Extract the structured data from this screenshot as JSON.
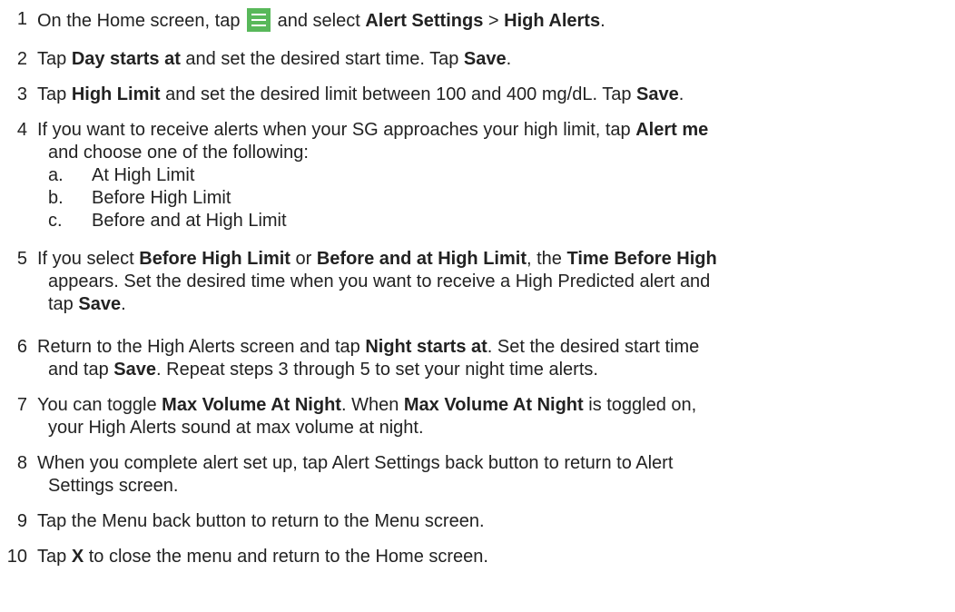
{
  "steps": [
    {
      "num": "1",
      "t1": "On the Home screen, tap ",
      "icon": "menu-icon",
      "t2": " and select ",
      "b1": "Alert Settings",
      "t3": " > ",
      "b2": "High Alerts",
      "t4": "."
    },
    {
      "num": "2",
      "t1": "Tap ",
      "b1": "Day starts at",
      "t2": " and set the desired start time. Tap ",
      "b2": "Save",
      "t3": "."
    },
    {
      "num": "3",
      "t1": "Tap ",
      "b1": "High Limit",
      "t2": " and set the desired limit between 100 and 400 mg/dL. Tap ",
      "b2": "Save",
      "t3": "."
    },
    {
      "num": "4",
      "t1": "If you want to receive alerts when your SG approaches your high limit, tap ",
      "b1": "Alert me",
      "t2": "and choose one of the following:",
      "options": [
        {
          "letter": "a.",
          "text": "At High Limit"
        },
        {
          "letter": "b.",
          "text": "Before High Limit"
        },
        {
          "letter": "c.",
          "text": "Before and at High Limit"
        }
      ]
    },
    {
      "num": "5",
      "t1": "If you select ",
      "b1": "Before High Limit",
      "t2": " or ",
      "b2": "Before and at High Limit",
      "t3": ", the ",
      "b3": "Time Before High",
      "t4": "appears. Set the desired time when you want to receive a High Predicted alert and",
      "t5": "tap ",
      "b4": "Save",
      "t6": "."
    },
    {
      "num": "6",
      "t1": "Return to the High Alerts screen and tap ",
      "b1": "Night starts at",
      "t2": ". Set the desired start time",
      "t3": "and tap ",
      "b2": "Save",
      "t4": ". Repeat steps 3 through 5 to set your night time alerts."
    },
    {
      "num": "7",
      "t1": "You can toggle ",
      "b1": "Max Volume At Night",
      "t2": ". When ",
      "b2": "Max Volume At Night",
      "t3": " is toggled on,",
      "t4": "your High Alerts sound at max volume at night."
    },
    {
      "num": "8",
      "t1": "When you complete alert set up, tap Alert Settings back button to return to Alert",
      "t2": "Settings screen."
    },
    {
      "num": "9",
      "t1": "Tap the Menu back button to return to the Menu screen."
    },
    {
      "num": "10",
      "t1": "Tap ",
      "b1": "X",
      "t2": " to close the menu and return to the Home screen."
    }
  ]
}
